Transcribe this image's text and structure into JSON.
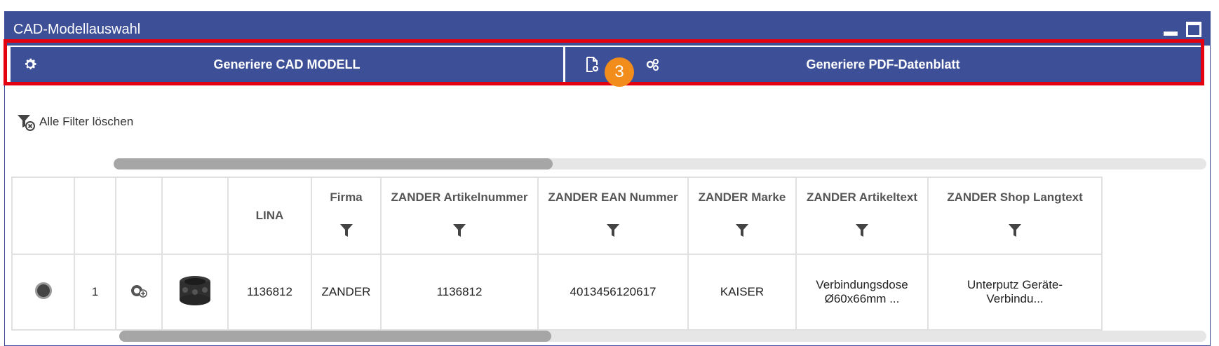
{
  "window": {
    "title": "CAD-Modellauswahl"
  },
  "toolbar": {
    "generate_cad_label": "Generiere CAD MODELL",
    "generate_pdf_label": "Generiere PDF-Datenblatt",
    "step_badge": "3"
  },
  "filter": {
    "clear_label": "Alle Filter löschen"
  },
  "table": {
    "columns": [
      "LINA",
      "Firma",
      "ZANDER Artikelnummer",
      "ZANDER EAN Nummer",
      "ZANDER Marke",
      "ZANDER Artikeltext",
      "ZANDER Shop Langtext"
    ],
    "rows": [
      {
        "index": "1",
        "lina": "1136812",
        "firma": "ZANDER",
        "artikelnummer": "1136812",
        "ean": "4013456120617",
        "marke": "KAISER",
        "artikeltext": "Verbindungsdose Ø60x66mm ...",
        "langtext": "Unterputz Geräte-Verbindu..."
      }
    ]
  },
  "colors": {
    "header_blue": "#3c4f97",
    "highlight_red": "#e3000f",
    "badge_orange": "#f28c1a"
  }
}
